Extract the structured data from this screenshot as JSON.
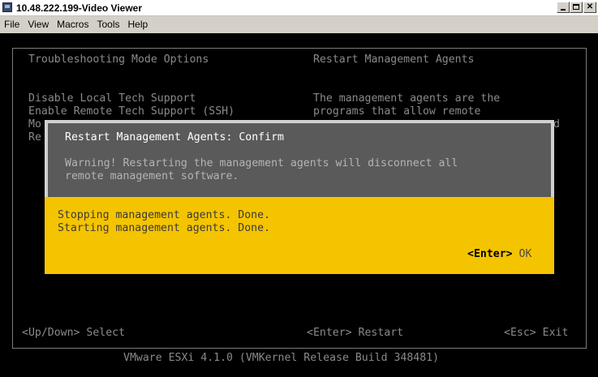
{
  "window": {
    "title": "10.48.222.199-Video Viewer",
    "icon": "console-window-icon"
  },
  "menu": [
    "File",
    "View",
    "Macros",
    "Tools",
    "Help"
  ],
  "console": {
    "left_header": "Troubleshooting Mode Options",
    "right_header": "Restart Management Agents",
    "options": [
      "Disable Local Tech Support",
      "Enable Remote Tech Support (SSH)",
      "Mo",
      "Re"
    ],
    "description_lines": [
      "The management agents are the",
      "programs that allow remote",
      "d"
    ],
    "hints": {
      "select": "<Up/Down> Select",
      "restart": "<Enter> Restart",
      "exit": "<Esc> Exit"
    },
    "footer": "VMware ESXi 4.1.0 (VMKernel Release Build 348481)"
  },
  "dialog": {
    "title": "Restart Management Agents: Confirm",
    "warning_lines": [
      "Warning! Restarting the management agents will disconnect all",
      "remote management software."
    ],
    "status_lines": [
      "Stopping management agents. Done.",
      "Starting management agents. Done."
    ],
    "ok_key": "<Enter>",
    "ok_label": "OK"
  },
  "colors": {
    "console_bg": "#000000",
    "dialog_header_bg": "#5a5a5a",
    "dialog_body_bg": "#f5c400",
    "dialog_border": "#d0d0d0"
  }
}
